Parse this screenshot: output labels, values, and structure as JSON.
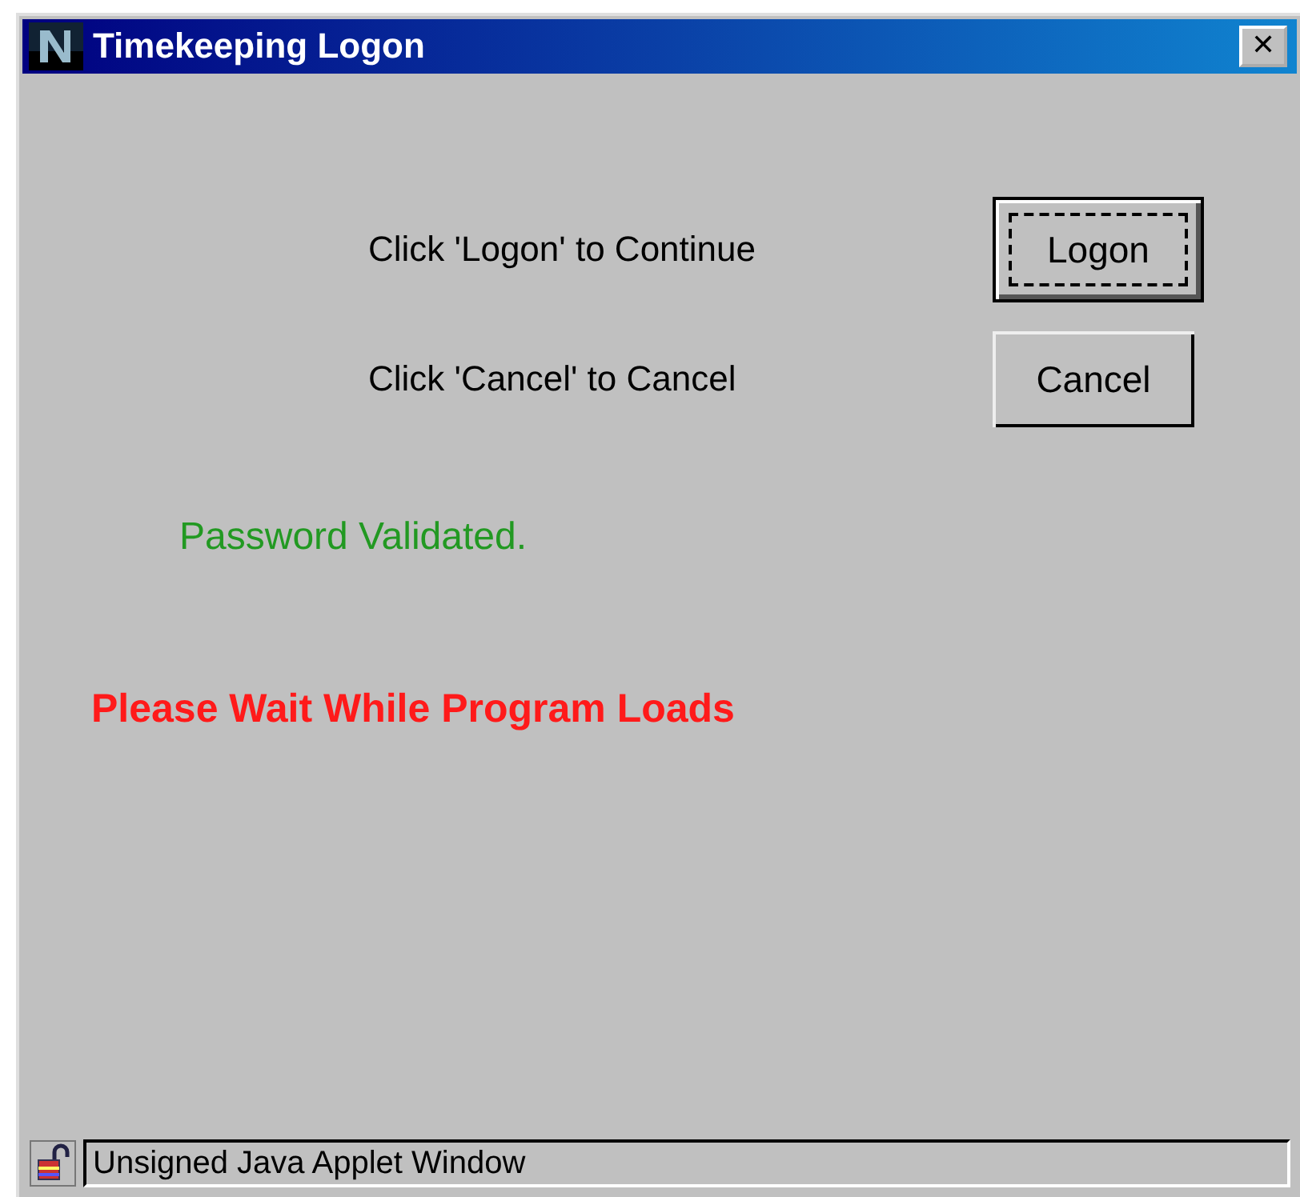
{
  "window": {
    "title": "Timekeeping Logon",
    "close": "✕"
  },
  "prompts": [
    {
      "text": "Click 'Logon' to Continue",
      "button": "Logon",
      "focused": true
    },
    {
      "text": "Click 'Cancel' to Cancel",
      "button": "Cancel",
      "focused": false
    }
  ],
  "messages": [
    {
      "kind": "success",
      "text": "Password Validated."
    },
    {
      "kind": "error",
      "text": "Please Wait While Program Loads"
    }
  ],
  "status_bar": {
    "text": "Unsigned Java Applet Window"
  }
}
